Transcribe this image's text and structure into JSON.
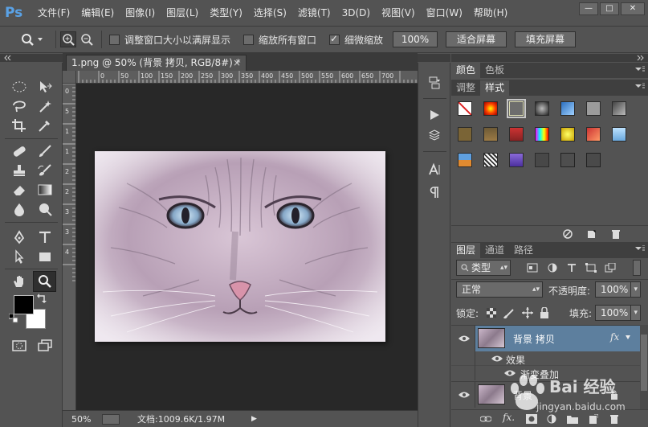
{
  "app": {
    "logo": "Ps"
  },
  "menu": [
    "文件(F)",
    "编辑(E)",
    "图像(I)",
    "图层(L)",
    "类型(Y)",
    "选择(S)",
    "滤镜(T)",
    "3D(D)",
    "视图(V)",
    "窗口(W)",
    "帮助(H)"
  ],
  "window_controls": {
    "minimize": "—",
    "maximize": "□",
    "close": "✕"
  },
  "options": {
    "resize_windows_label": "调整窗口大小以满屏显示",
    "resize_windows_checked": false,
    "zoom_all_label": "缩放所有窗口",
    "zoom_all_checked": false,
    "scrubby_label": "细微缩放",
    "scrubby_checked": true,
    "btn_100": "100%",
    "btn_fit": "适合屏幕",
    "btn_fill": "填充屏幕"
  },
  "document": {
    "tab_title": "1.png @ 50% (背景 拷贝, RGB/8#) *",
    "tab_close": "×",
    "ruler_h_labels": [
      "0",
      "50",
      "100",
      "150",
      "200",
      "250",
      "300",
      "350",
      "400",
      "450",
      "500",
      "550",
      "600",
      "650",
      "700"
    ],
    "ruler_v_labels": [
      "0",
      "5",
      "1",
      "1",
      "2",
      "2",
      "3",
      "3",
      "4"
    ]
  },
  "status": {
    "zoom": "50%",
    "doc_info": "文档:1009.6K/1.97M",
    "arrow": "▶"
  },
  "color_panel": {
    "tabs": [
      "颜色",
      "色板"
    ],
    "active": 0
  },
  "style_panel": {
    "tabs": [
      "调整",
      "样式"
    ],
    "active": 1
  },
  "layers_panel": {
    "tabs": [
      "图层",
      "通道",
      "路径"
    ],
    "active": 0,
    "filter_kind": "类型",
    "blend_mode": "正常",
    "opacity_label": "不透明度:",
    "opacity_value": "100%",
    "lock_label": "锁定:",
    "fill_label": "填充:",
    "fill_value": "100%",
    "layers": [
      {
        "name": "背景 拷贝",
        "fx": "fx",
        "selected": true
      },
      {
        "name": "效果",
        "sub": true
      },
      {
        "name": "渐变叠加",
        "sub": true
      },
      {
        "name": "背景",
        "locked": true
      }
    ]
  },
  "watermark": {
    "text": "Bai 经验",
    "url": "jingyan.baidu.com"
  },
  "colors": {
    "fg": "#000000",
    "bg": "#ffffff",
    "accent": "#5aa2e6",
    "selected_layer": "#5d7f9e"
  }
}
